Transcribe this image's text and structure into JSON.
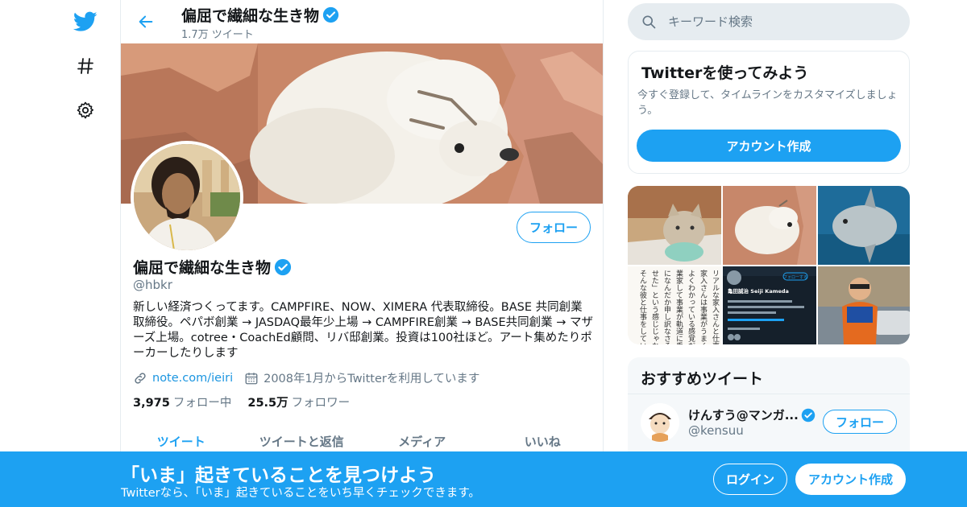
{
  "nav": {
    "icons": [
      "twitter-logo-icon",
      "hashtag-icon",
      "gear-icon"
    ]
  },
  "header": {
    "name": "偏屈で繊細な生き物",
    "tweet_count": "1.7万 ツイート"
  },
  "profile": {
    "name": "偏屈で繊細な生き物",
    "handle": "@hbkr",
    "follow_label": "フォロー",
    "bio": "新しい経済つくってます。CAMPFIRE、NOW、XIMERA 代表取締役。BASE 共同創業取締役。ペパボ創業 → JASDAQ最年少上場 → CAMPFIRE創業 → BASE共同創業 → マザーズ上場。cotree・CoachEd顧問、リバ邸創業。投資は100社ほど。アート集めたりポーカーしたりします",
    "link": "note.com/ieiri",
    "joined": "2008年1月からTwitterを利用しています",
    "following_count": "3,975",
    "following_label": "フォロー中",
    "followers_count": "25.5万",
    "followers_label": "フォロワー"
  },
  "tabs": [
    {
      "label": "ツイート"
    },
    {
      "label": "ツイートと返信"
    },
    {
      "label": "メディア"
    },
    {
      "label": "いいね"
    }
  ],
  "search": {
    "placeholder": "キーワード検索"
  },
  "signup_card": {
    "title": "Twitterを使ってみよう",
    "description": "今すぐ登録して、タイムラインをカスタマイズしましょう。",
    "button_label": "アカウント作成"
  },
  "media_grid": {
    "items": [
      "cat-on-laptop",
      "white-goat",
      "sunfish",
      "japanese-text",
      "profile-screenshot",
      "costumed-man"
    ],
    "screenshot_name": "亀田誠治 Seiji Kameda",
    "screenshot_follow": "フォローする",
    "text_image_lines": [
      "リアルな家入さんと仕事が",
      "家入さんは事業がうまく",
      "よくわかっている感覚だ",
      "業家して事業が軌道に乗っ",
      "になんだか申し訳なさそう",
      "せた」という感じじゃない",
      "そんな彼と仕事をしていく"
    ]
  },
  "recommended": {
    "title": "おすすめツイート",
    "user": {
      "name": "けんすう@マンガ...",
      "handle": "@kensuu",
      "follow_label": "フォロー"
    }
  },
  "bottom_bar": {
    "title": "「いま」起きていることを見つけよう",
    "subtitle": "Twitterなら、「いま」起きていることをいち早くチェックできます。",
    "login_label": "ログイン",
    "signup_label": "アカウント作成"
  },
  "colors": {
    "brand": "#1da1f2",
    "muted_text": "#657786",
    "link": "#1b95e0"
  }
}
